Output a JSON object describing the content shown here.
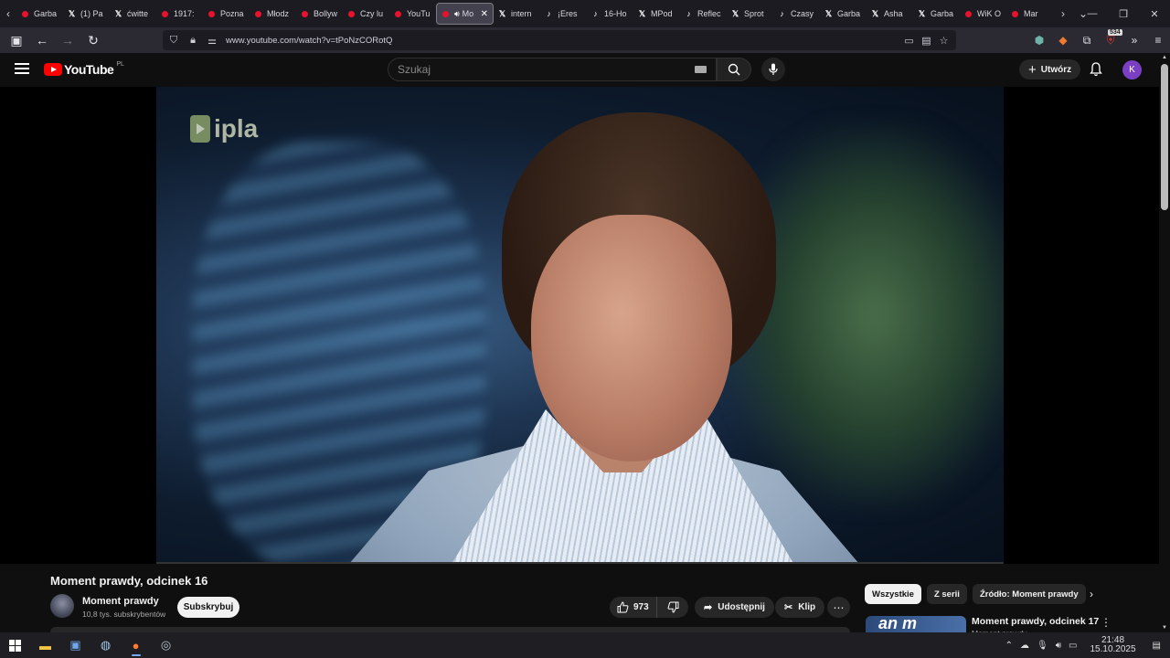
{
  "browser": {
    "tabs": [
      {
        "icon": "youtube-icon",
        "title": "Garba"
      },
      {
        "icon": "x-icon",
        "title": "(1) Pa"
      },
      {
        "icon": "x-icon",
        "title": "ćwitte"
      },
      {
        "icon": "youtube-icon",
        "title": "1917:"
      },
      {
        "icon": "youtube-icon",
        "title": "Pozna"
      },
      {
        "icon": "youtube-icon",
        "title": "Młodz"
      },
      {
        "icon": "youtube-icon",
        "title": "Bollyw"
      },
      {
        "icon": "youtube-icon",
        "title": "Czy lu"
      },
      {
        "icon": "youtube-icon",
        "title": "YouTu"
      },
      {
        "icon": "youtube-icon",
        "title": "Mo",
        "active": true
      },
      {
        "icon": "x-icon",
        "title": "intern"
      },
      {
        "icon": "tiktok-icon",
        "title": "¡Eres"
      },
      {
        "icon": "tiktok-icon",
        "title": "16-Ho"
      },
      {
        "icon": "x-icon",
        "title": "MPod"
      },
      {
        "icon": "tiktok-icon",
        "title": "Reflec"
      },
      {
        "icon": "x-icon",
        "title": "Sprot"
      },
      {
        "icon": "tiktok-icon",
        "title": "Czasy"
      },
      {
        "icon": "x-icon",
        "title": "Garba"
      },
      {
        "icon": "x-icon",
        "title": "Asha"
      },
      {
        "icon": "x-icon",
        "title": "Garba"
      },
      {
        "icon": "youtube-icon",
        "title": "WiK O"
      },
      {
        "icon": "youtube-icon",
        "title": "Mar"
      }
    ],
    "url": "www.youtube.com/watch?v=tPoNzCORotQ",
    "extensions_badge": "534"
  },
  "youtube": {
    "logo_text": "YouTube",
    "country_code": "PL",
    "search_placeholder": "Szukaj",
    "create_label": "Utwórz",
    "avatar_letter": "K",
    "watermark": "ipla",
    "video": {
      "title": "Moment prawdy, odcinek 16",
      "channel_name": "Moment prawdy",
      "subscribers": "10,8 tys. subskrybentów",
      "subscribe_label": "Subskrybuj",
      "likes": "973",
      "share_label": "Udostępnij",
      "clip_label": "Klip"
    },
    "chips": [
      "Wszystkie",
      "Z serii",
      "Źródło: Moment prawdy"
    ],
    "recommendation": {
      "title": "Moment prawdy, odcinek 17",
      "channel": "Moment prawdy",
      "thumb_text": "an m"
    }
  },
  "taskbar": {
    "time": "21:48",
    "date": "15.10.2025"
  }
}
